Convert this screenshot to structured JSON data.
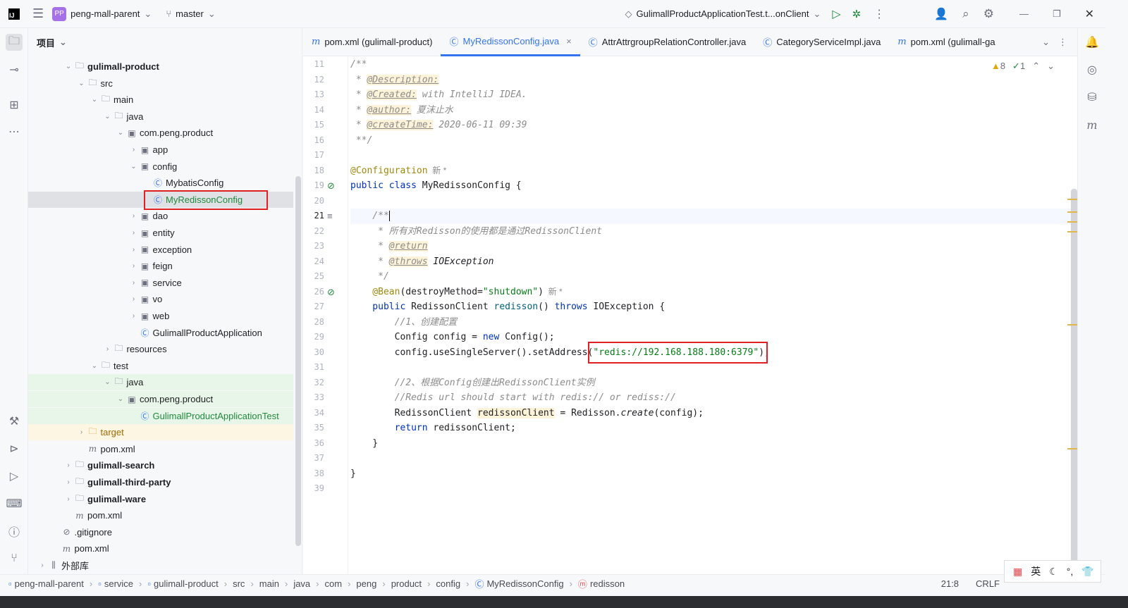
{
  "titlebar": {
    "project": "peng-mall-parent",
    "project_badge": "PP",
    "branch": "master",
    "run_config": "GulimallProductApplicationTest.t...onClient"
  },
  "project_panel": {
    "title": "项目"
  },
  "tree": [
    {
      "label": "gulimall-product",
      "level": 2,
      "arrow": "v",
      "icon": "module",
      "bold": true
    },
    {
      "label": "src",
      "level": 3,
      "arrow": "v",
      "icon": "folder"
    },
    {
      "label": "main",
      "level": 4,
      "arrow": "v",
      "icon": "folder"
    },
    {
      "label": "java",
      "level": 5,
      "arrow": "v",
      "icon": "source-folder"
    },
    {
      "label": "com.peng.product",
      "level": 6,
      "arrow": "v",
      "icon": "package"
    },
    {
      "label": "app",
      "level": 7,
      "arrow": ">",
      "icon": "package"
    },
    {
      "label": "config",
      "level": 7,
      "arrow": "v",
      "icon": "package"
    },
    {
      "label": "MybatisConfig",
      "level": 8,
      "arrow": "",
      "icon": "class"
    },
    {
      "label": "MyRedissonConfig",
      "level": 8,
      "arrow": "",
      "icon": "class",
      "selected": true,
      "color": "green"
    },
    {
      "label": "dao",
      "level": 7,
      "arrow": ">",
      "icon": "package"
    },
    {
      "label": "entity",
      "level": 7,
      "arrow": ">",
      "icon": "package"
    },
    {
      "label": "exception",
      "level": 7,
      "arrow": ">",
      "icon": "package"
    },
    {
      "label": "feign",
      "level": 7,
      "arrow": ">",
      "icon": "package"
    },
    {
      "label": "service",
      "level": 7,
      "arrow": ">",
      "icon": "package"
    },
    {
      "label": "vo",
      "level": 7,
      "arrow": ">",
      "icon": "package"
    },
    {
      "label": "web",
      "level": 7,
      "arrow": ">",
      "icon": "package"
    },
    {
      "label": "GulimallProductApplication",
      "level": 7,
      "arrow": "",
      "icon": "class-app"
    },
    {
      "label": "resources",
      "level": 5,
      "arrow": ">",
      "icon": "resources-folder"
    },
    {
      "label": "test",
      "level": 4,
      "arrow": "v",
      "icon": "folder"
    },
    {
      "label": "java",
      "level": 5,
      "arrow": "v",
      "icon": "test-folder",
      "bg": "green"
    },
    {
      "label": "com.peng.product",
      "level": 6,
      "arrow": "v",
      "icon": "package",
      "bg": "green"
    },
    {
      "label": "GulimallProductApplicationTest",
      "level": 7,
      "arrow": "",
      "icon": "class-test",
      "bg": "green",
      "color": "green"
    },
    {
      "label": "target",
      "level": 3,
      "arrow": ">",
      "icon": "excluded-folder",
      "bg": "yellow",
      "color": "yellow"
    },
    {
      "label": "pom.xml",
      "level": 3,
      "arrow": "",
      "icon": "maven"
    },
    {
      "label": "gulimall-search",
      "level": 2,
      "arrow": ">",
      "icon": "module",
      "bold": true
    },
    {
      "label": "gulimall-third-party",
      "level": 2,
      "arrow": ">",
      "icon": "module",
      "bold": true
    },
    {
      "label": "gulimall-ware",
      "level": 2,
      "arrow": ">",
      "icon": "module",
      "bold": true
    },
    {
      "label": "pom.xml",
      "level": 2,
      "arrow": "",
      "icon": "maven"
    },
    {
      "label": ".gitignore",
      "level": 1,
      "arrow": "",
      "icon": "ignore"
    },
    {
      "label": "pom.xml",
      "level": 1,
      "arrow": "",
      "icon": "maven"
    },
    {
      "label": "外部库",
      "level": 0,
      "arrow": ">",
      "icon": "library"
    }
  ],
  "tabs": [
    {
      "label": "pom.xml (gulimall-product)",
      "icon": "maven"
    },
    {
      "label": "MyRedissonConfig.java",
      "icon": "class",
      "active": true,
      "closable": true
    },
    {
      "label": "AttrAttrgroupRelationController.java",
      "icon": "class"
    },
    {
      "label": "CategoryServiceImpl.java",
      "icon": "class"
    },
    {
      "label": "pom.xml (gulimall-ga",
      "icon": "maven"
    }
  ],
  "inspections": {
    "warnings": "8",
    "ok": "1"
  },
  "code": [
    {
      "n": "11",
      "t": [
        [
          "/**",
          "cm"
        ]
      ]
    },
    {
      "n": "12",
      "t": [
        [
          " * ",
          "cm"
        ],
        [
          "@Description:",
          "tag"
        ]
      ]
    },
    {
      "n": "13",
      "t": [
        [
          " * ",
          "cm"
        ],
        [
          "@Created:",
          "tag"
        ],
        [
          " with IntelliJ IDEA.",
          "cm"
        ]
      ]
    },
    {
      "n": "14",
      "t": [
        [
          " * ",
          "cm"
        ],
        [
          "@author:",
          "tag"
        ],
        [
          " 夏沫止水",
          "cm"
        ]
      ]
    },
    {
      "n": "15",
      "t": [
        [
          " * ",
          "cm"
        ],
        [
          "@createTime:",
          "tag"
        ],
        [
          " 2020-06-11 09:39",
          "cm"
        ]
      ]
    },
    {
      "n": "16",
      "t": [
        [
          " **/",
          "cm"
        ]
      ]
    },
    {
      "n": "17",
      "t": []
    },
    {
      "n": "18",
      "t": [
        [
          "@Configuration",
          "an"
        ],
        [
          "  新 *",
          "hint"
        ]
      ]
    },
    {
      "n": "19",
      "t": [
        [
          "public class ",
          "kw"
        ],
        [
          "MyRedissonConfig {",
          ""
        ]
      ],
      "gutter": "bean"
    },
    {
      "n": "20",
      "t": []
    },
    {
      "n": "21",
      "t": [
        [
          "    /**",
          "cm"
        ]
      ],
      "current": true,
      "gutter": "doc"
    },
    {
      "n": "22",
      "t": [
        [
          "     * 所有对Redisson的使用都是通过RedissonClient",
          "cm"
        ]
      ]
    },
    {
      "n": "23",
      "t": [
        [
          "     * ",
          "cm"
        ],
        [
          "@return",
          "tag"
        ]
      ]
    },
    {
      "n": "24",
      "t": [
        [
          "     * ",
          "cm"
        ],
        [
          "@throws",
          "tag"
        ],
        [
          " IOException",
          "it"
        ]
      ]
    },
    {
      "n": "25",
      "t": [
        [
          "     */",
          "cm"
        ]
      ]
    },
    {
      "n": "26",
      "t": [
        [
          "    @Bean",
          "an"
        ],
        [
          "(destroyMethod=",
          ""
        ],
        [
          "\"shutdown\"",
          "str"
        ],
        [
          ")",
          ""
        ],
        [
          "  新 *",
          "hint"
        ]
      ],
      "gutter": "bean"
    },
    {
      "n": "27",
      "t": [
        [
          "    public ",
          "kw"
        ],
        [
          "RedissonClient ",
          ""
        ],
        [
          "redisson",
          "mth"
        ],
        [
          "() ",
          ""
        ],
        [
          "throws ",
          "kw"
        ],
        [
          "IOException {",
          ""
        ]
      ]
    },
    {
      "n": "28",
      "t": [
        [
          "        //1、创建配置",
          "cm"
        ]
      ]
    },
    {
      "n": "29",
      "t": [
        [
          "        Config config = ",
          ""
        ],
        [
          "new ",
          "kw"
        ],
        [
          "Config();",
          ""
        ]
      ]
    },
    {
      "n": "30",
      "t": [
        [
          "        config.useSingleServer().setAddress(",
          ""
        ],
        [
          "\"redis://192.168.188.180:6379\"",
          "str"
        ],
        [
          ");",
          ""
        ]
      ]
    },
    {
      "n": "31",
      "t": []
    },
    {
      "n": "32",
      "t": [
        [
          "        //2、根据Config创建出RedissonClient实例",
          "cm"
        ]
      ]
    },
    {
      "n": "33",
      "t": [
        [
          "        //Redis url should start with redis:// or rediss://",
          "cm"
        ]
      ]
    },
    {
      "n": "34",
      "t": [
        [
          "        RedissonClient ",
          ""
        ],
        [
          "redissonClient",
          "var"
        ],
        [
          " = Redisson.",
          ""
        ],
        [
          "create",
          "it"
        ],
        [
          "(config);",
          ""
        ]
      ]
    },
    {
      "n": "35",
      "t": [
        [
          "        return ",
          "kw"
        ],
        [
          "redissonClient;",
          ""
        ]
      ]
    },
    {
      "n": "36",
      "t": [
        [
          "    }",
          ""
        ]
      ]
    },
    {
      "n": "37",
      "t": []
    },
    {
      "n": "38",
      "t": [
        [
          "}",
          ""
        ]
      ]
    },
    {
      "n": "39",
      "t": []
    }
  ],
  "statusbar": {
    "breadcrumbs": [
      "peng-mall-parent",
      "service",
      "gulimall-product",
      "src",
      "main",
      "java",
      "com",
      "peng",
      "product",
      "config",
      "MyRedissonConfig",
      "redisson"
    ],
    "position": "21:8",
    "line_ending": "CRLF"
  },
  "ime": {
    "lang": "英"
  },
  "colors": {
    "accent": "#3574f0",
    "highlight_box": "#e02020",
    "string": "#067d17",
    "keyword": "#0033b3"
  }
}
